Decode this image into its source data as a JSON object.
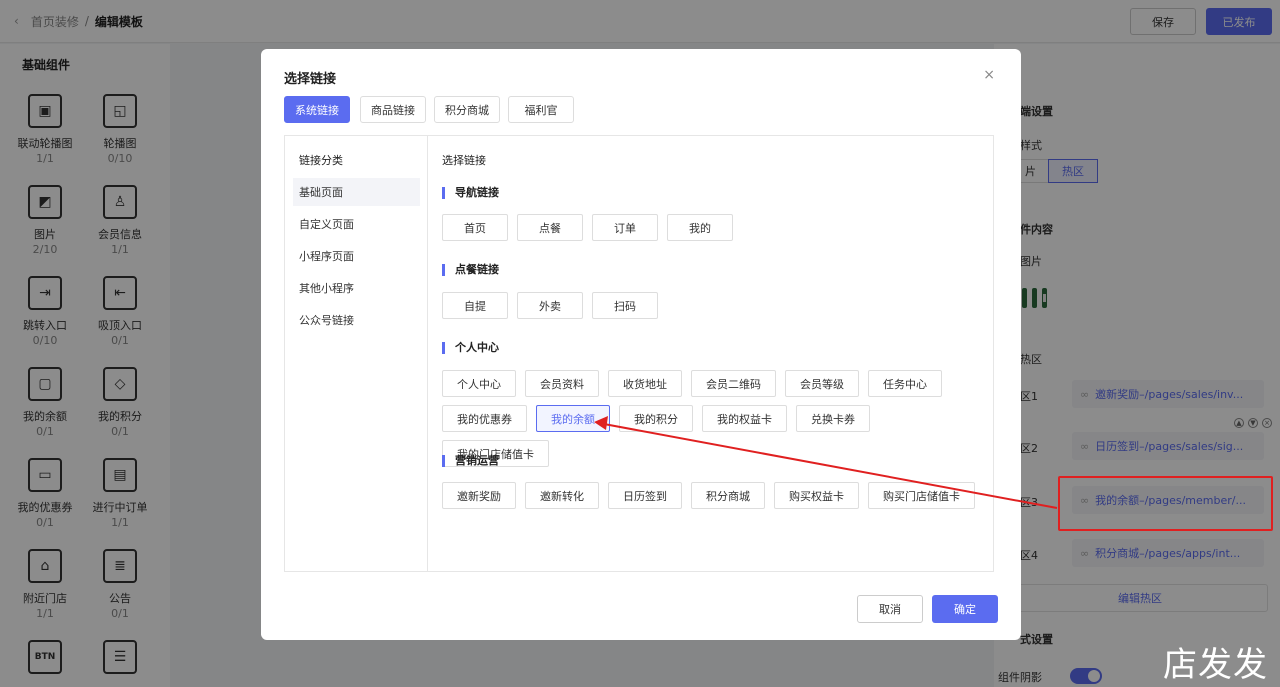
{
  "topbar": {
    "back": "‹",
    "crumb_parent": "首页装修",
    "crumb_sep": "/",
    "crumb_current": "编辑模板",
    "save": "保存",
    "publish": "已发布"
  },
  "left": {
    "title": "基础组件",
    "components": [
      {
        "name": "联动轮播图",
        "count": "1/1"
      },
      {
        "name": "轮播图",
        "count": "0/10"
      },
      {
        "name": "图片",
        "count": "2/10"
      },
      {
        "name": "会员信息",
        "count": "1/1"
      },
      {
        "name": "跳转入口",
        "count": "0/10"
      },
      {
        "name": "吸顶入口",
        "count": "0/1"
      },
      {
        "name": "我的余额",
        "count": "0/1"
      },
      {
        "name": "我的积分",
        "count": "0/1"
      },
      {
        "name": "我的优惠券",
        "count": "0/1"
      },
      {
        "name": "进行中订单",
        "count": "1/1"
      },
      {
        "name": "附近门店",
        "count": "1/1"
      },
      {
        "name": "公告",
        "count": "0/1"
      },
      {
        "name": "",
        "count": ""
      },
      {
        "name": "",
        "count": ""
      }
    ]
  },
  "right": {
    "section1": "端设置",
    "style_label": "样式",
    "tab_img": "片",
    "tab_hot": "热区",
    "section2": "件内容",
    "img_label": "图片",
    "hot_label": "热区",
    "rows": [
      {
        "label": "区1",
        "link": "邀新奖励–/pages/sales/inv..."
      },
      {
        "label": "区2",
        "link": "日历签到–/pages/sales/sig..."
      },
      {
        "label": "区3",
        "link": "我的余额–/pages/member/..."
      },
      {
        "label": "区4",
        "link": "积分商城–/pages/apps/int..."
      }
    ],
    "edit_hot": "编辑热区",
    "section3": "式设置",
    "shadow_label": "组件阴影",
    "shadow_on": true
  },
  "modal": {
    "title": "选择链接",
    "close": "×",
    "tabs": [
      "系统链接",
      "商品链接",
      "积分商城",
      "福利官"
    ],
    "active_tab": 0,
    "cat_header": "链接分类",
    "categories": [
      "基础页面",
      "自定义页面",
      "小程序页面",
      "其他小程序",
      "公众号链接"
    ],
    "active_category": 0,
    "links_header": "选择链接",
    "sections": [
      {
        "title": "导航链接",
        "items": [
          "首页",
          "点餐",
          "订单",
          "我的"
        ]
      },
      {
        "title": "点餐链接",
        "items": [
          "自提",
          "外卖",
          "扫码"
        ]
      },
      {
        "title": "个人中心",
        "items": [
          "个人中心",
          "会员资料",
          "收货地址",
          "会员二维码",
          "会员等级",
          "任务中心",
          "我的优惠券",
          "我的余额",
          "我的积分",
          "我的权益卡",
          "兑换卡券",
          "我的门店储值卡"
        ]
      },
      {
        "title": "营销运营",
        "items": [
          "邀新奖励",
          "邀新转化",
          "日历签到",
          "积分商城",
          "购买权益卡",
          "购买门店储值卡"
        ]
      }
    ],
    "selected_item": "我的余额",
    "cancel": "取消",
    "ok": "确定"
  },
  "watermark": "店发发",
  "colors": {
    "accent": "#5b6cf0",
    "annotation": "#e02020"
  }
}
